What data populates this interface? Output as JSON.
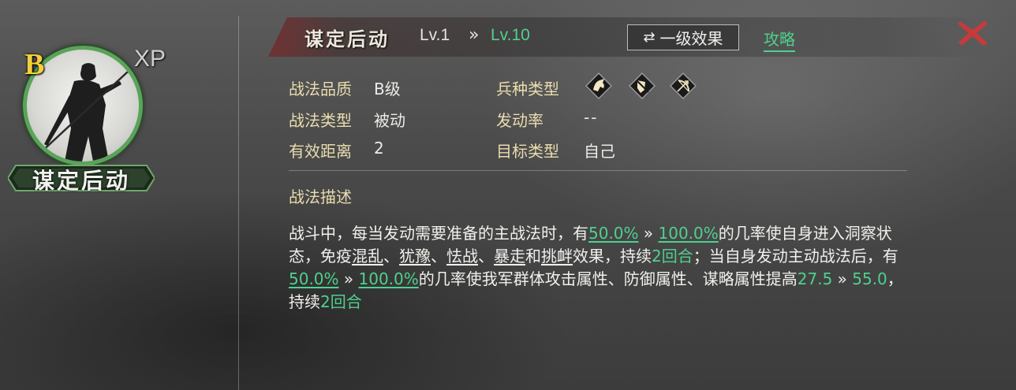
{
  "card": {
    "grade": "B",
    "xp_label": "XP",
    "name": "谋定后动"
  },
  "header": {
    "title": "谋定后动",
    "level_current": "Lv.1",
    "level_arrow": "»",
    "level_max": "Lv.10",
    "effect_button_icon": "swap-icon",
    "effect_button_label": "一级效果",
    "guide_link": "攻略",
    "close_icon": "close-icon"
  },
  "attributes": {
    "quality_label": "战法品质",
    "quality_value": "B级",
    "type_label": "战法类型",
    "type_value": "被动",
    "range_label": "有效距离",
    "range_value": "2",
    "troop_label": "兵种类型",
    "troop_icons": [
      "cavalry-icon",
      "shield-infantry-icon",
      "archer-icon"
    ],
    "trigger_label": "发动率",
    "trigger_value": "--",
    "target_label": "目标类型",
    "target_value": "自己"
  },
  "description": {
    "heading": "战法描述",
    "t1": "战斗中，每当发动需要准备的主战法时，有",
    "v1": "50.0%",
    "a1": " » ",
    "v2": "100.0%",
    "t2": "的几率使自身进入洞察状态，免疫",
    "k1": "混乱",
    "s1": "、",
    "k2": "犹豫",
    "s2": "、",
    "k3": "怯战",
    "s3": "、",
    "k4": "暴走",
    "s4": "和",
    "k5": "挑衅",
    "t3": "效果，持续",
    "d1": "2回合",
    "t4": "；当自身发动主动战法后，有",
    "v3": "50.0%",
    "a2": " » ",
    "v4": "100.0%",
    "t5": "的几率使我军群体攻击属性、防御属性、谋略属性提高",
    "v5": "27.5",
    "a3": " » ",
    "v6": "55.0",
    "t6": "，持续",
    "d2": "2回合"
  },
  "colors": {
    "accent_green": "#4fd08e",
    "label_gold": "#e9dcae",
    "grade_yellow": "#f3cf3b",
    "close_red": "#c83a3a",
    "portrait_ring": "#5aa35a"
  }
}
